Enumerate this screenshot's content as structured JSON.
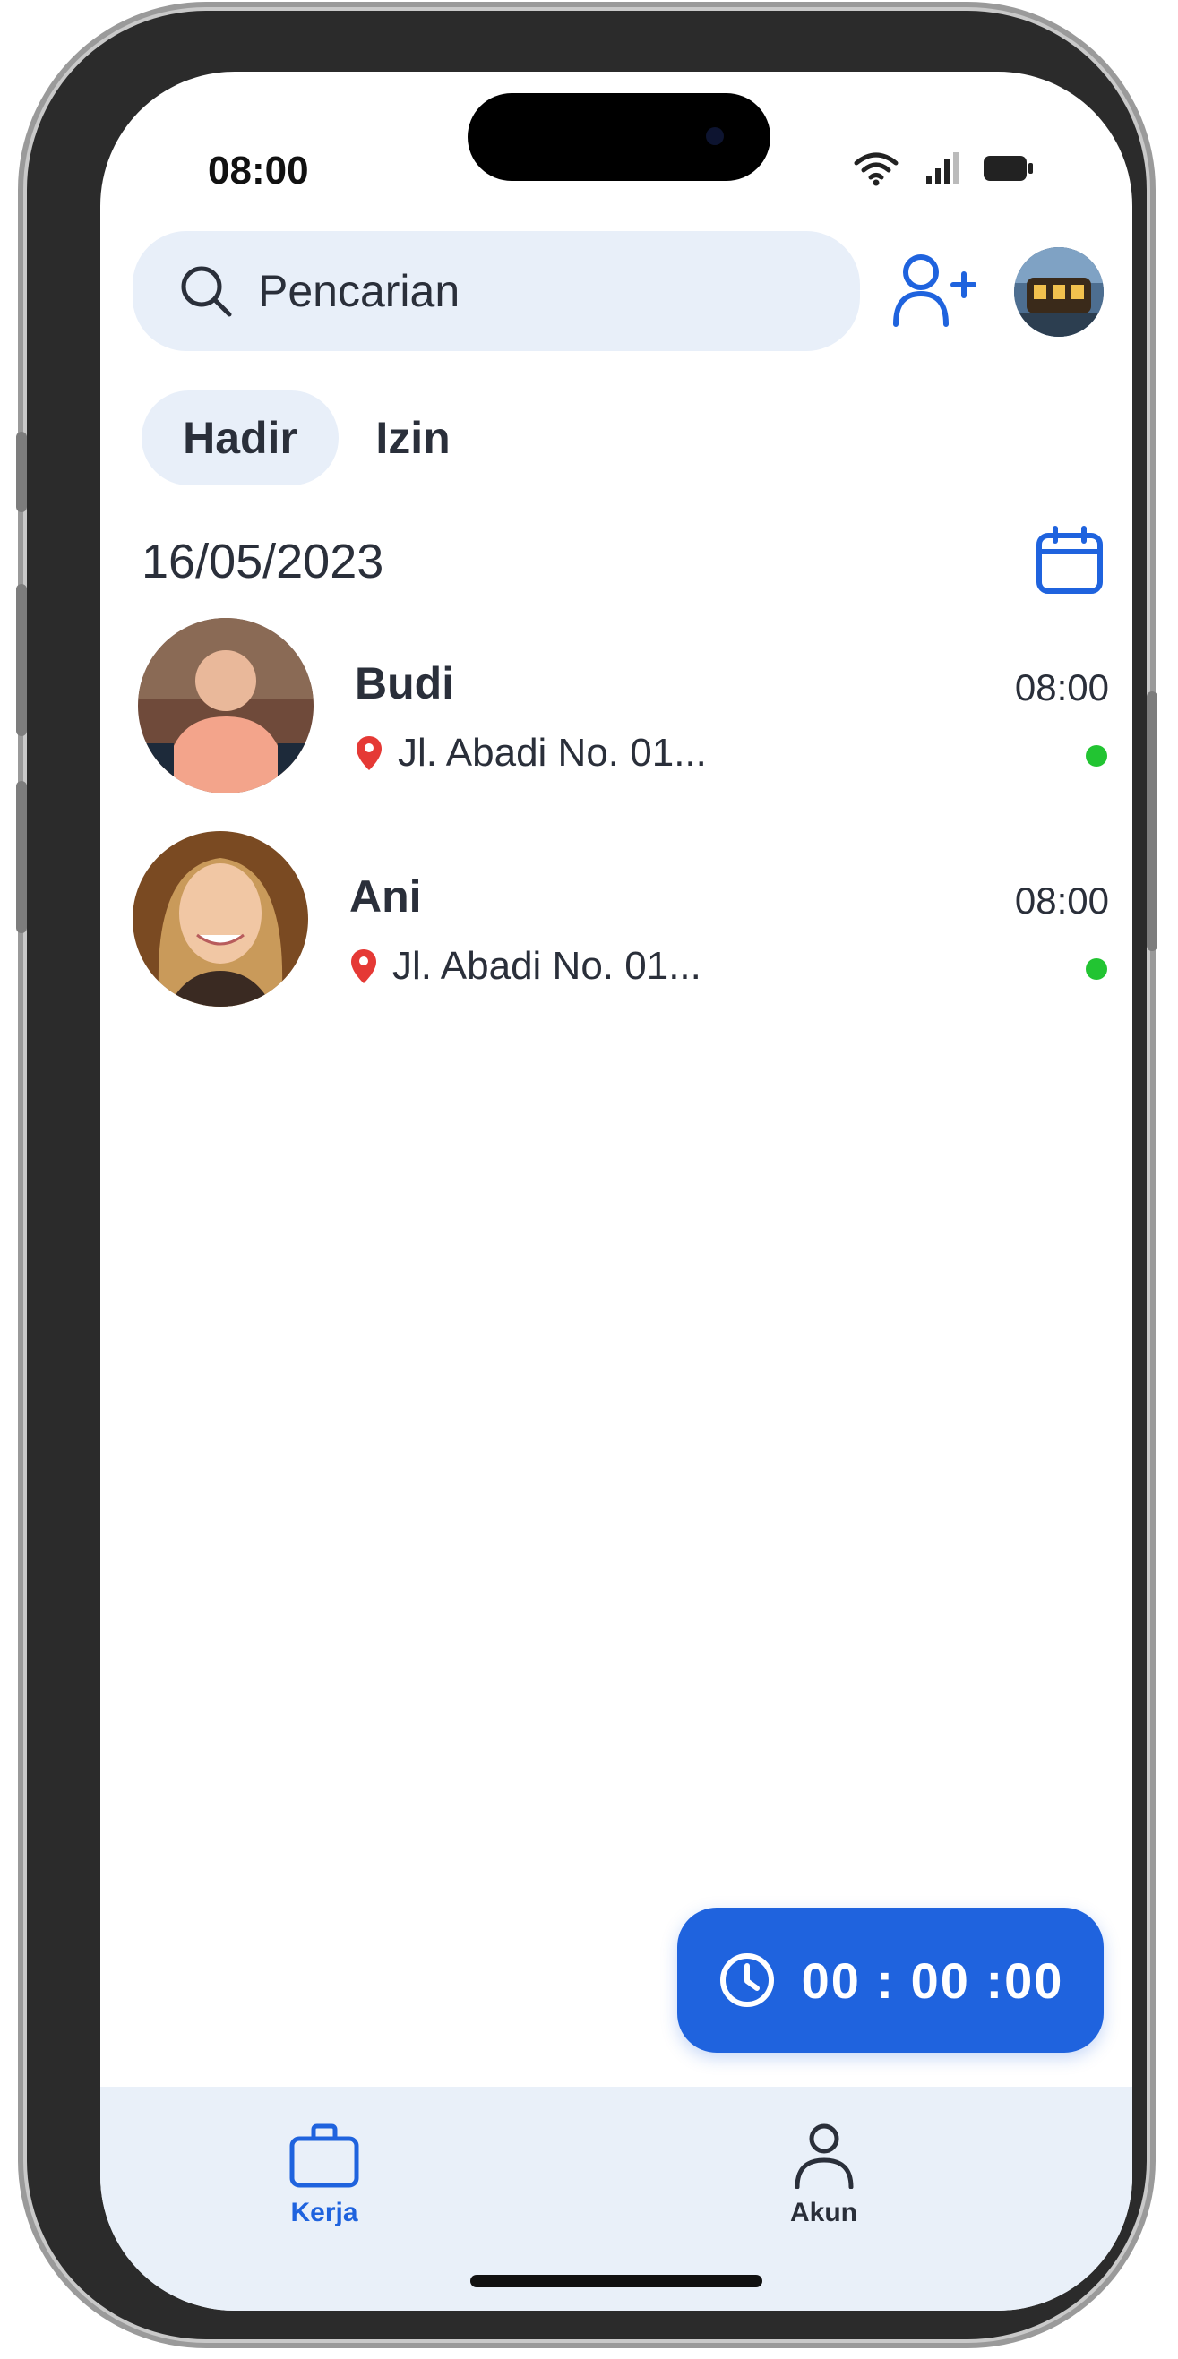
{
  "status_bar": {
    "time": "08:00"
  },
  "search": {
    "placeholder": "Pencarian"
  },
  "tabs": [
    {
      "label": "Hadir",
      "active": true
    },
    {
      "label": "Izin",
      "active": false
    }
  ],
  "date": "16/05/2023",
  "attendance": [
    {
      "name": "Budi",
      "time": "08:00",
      "address": "Jl. Abadi No. 01...",
      "status_color": "#22c432"
    },
    {
      "name": "Ani",
      "time": "08:00",
      "address": "Jl. Abadi No. 01...",
      "status_color": "#22c432"
    }
  ],
  "timer": {
    "value": "00 : 00 :00"
  },
  "bottom_nav": {
    "items": [
      {
        "label": "Kerja",
        "icon": "briefcase-icon",
        "active": true
      },
      {
        "label": "Akun",
        "icon": "user-icon",
        "active": false
      }
    ]
  },
  "colors": {
    "accent": "#1f63de",
    "surface": "#e8eff9",
    "online": "#22c432",
    "pin": "#e53935"
  }
}
